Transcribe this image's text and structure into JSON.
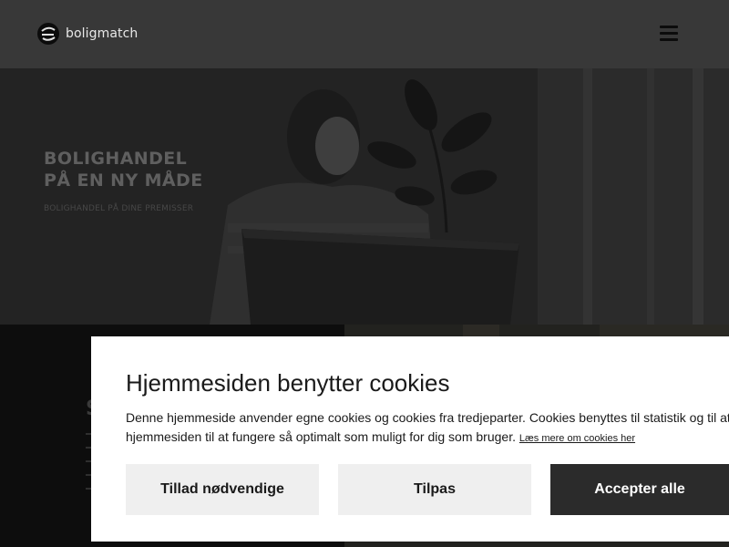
{
  "header": {
    "logo_text": "boligmatch",
    "menu_icon": "hamburger-menu-icon"
  },
  "hero": {
    "title_line1": "BOLIGHANDEL",
    "title_line2": "PÅ EN NY MÅDE",
    "subtitle": "BOLIGHANDEL PÅ DINE PREMISSER"
  },
  "section": {
    "heading_letter": "S"
  },
  "cookie_banner": {
    "title": "Hjemmesiden benytter cookies",
    "body": "Denne hjemmeside anvender egne cookies og cookies fra tredjeparter. Cookies benyttes til statistik og til at hjemmesiden til at fungere så optimalt som muligt for dig som bruger.",
    "link": "Læs mere om cookies her",
    "buttons": {
      "necessary": "Tillad nødvendige",
      "customize": "Tilpas",
      "accept_all": "Accepter alle"
    }
  },
  "colors": {
    "header_bg": "#383838",
    "overlay_bg": "#242424",
    "primary_button": "#2b2b2b",
    "secondary_button": "#efefef"
  }
}
